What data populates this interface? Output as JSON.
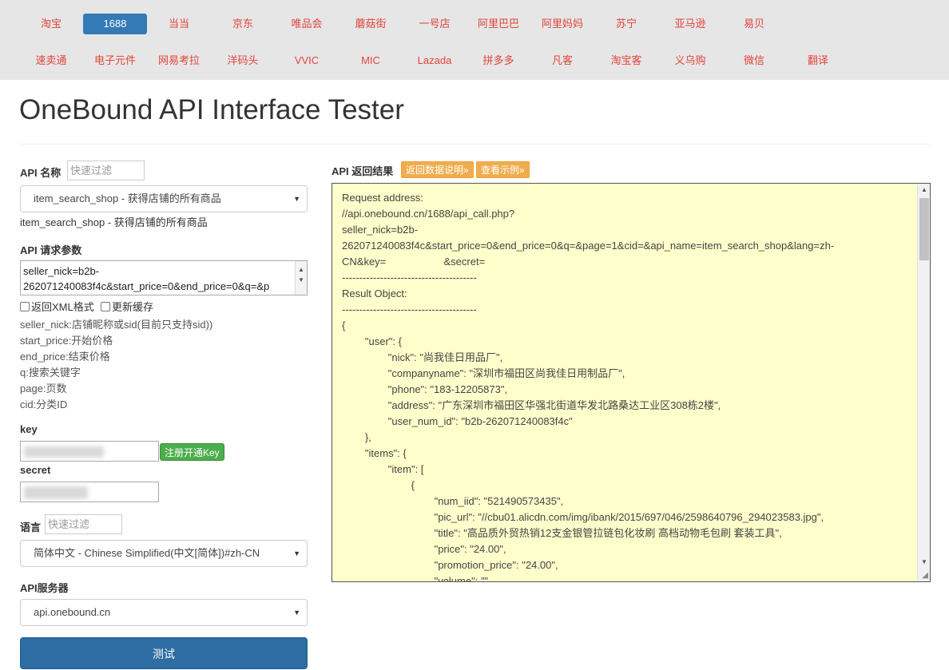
{
  "nav": {
    "row1": [
      {
        "label": "淘宝",
        "active": false
      },
      {
        "label": "1688",
        "active": true
      },
      {
        "label": "当当",
        "active": false
      },
      {
        "label": "京东",
        "active": false
      },
      {
        "label": "唯品会",
        "active": false
      },
      {
        "label": "蘑菇街",
        "active": false
      },
      {
        "label": "一号店",
        "active": false
      },
      {
        "label": "阿里巴巴",
        "active": false
      },
      {
        "label": "阿里妈妈",
        "active": false
      },
      {
        "label": "苏宁",
        "active": false
      },
      {
        "label": "亚马逊",
        "active": false
      },
      {
        "label": "易贝",
        "active": false
      }
    ],
    "row2": [
      {
        "label": "速卖通"
      },
      {
        "label": "电子元件"
      },
      {
        "label": "网易考拉"
      },
      {
        "label": "洋码头"
      },
      {
        "label": "VVIC"
      },
      {
        "label": "MIC"
      },
      {
        "label": "Lazada"
      },
      {
        "label": "拼多多"
      },
      {
        "label": "凡客"
      },
      {
        "label": "淘宝客"
      },
      {
        "label": "义乌购"
      },
      {
        "label": "微信"
      },
      {
        "label": "翻译"
      }
    ]
  },
  "page": {
    "title": "OneBound API Interface Tester"
  },
  "left": {
    "api_name_label": "API 名称",
    "api_filter_placeholder": "快速过滤",
    "api_select_value": "item_search_shop - 获得店铺的所有商品",
    "api_selected_text": "item_search_shop - 获得店铺的所有商品",
    "params_label": "API 请求参数",
    "params_value": "seller_nick=b2b-\n262071240083f4c&start_price=0&end_price=0&q=&p",
    "xml_checkbox": "返回XML格式",
    "cache_checkbox": "更新缓存",
    "param_desc": [
      "seller_nick:店铺昵称或sid(目前只支持sid))",
      "start_price:开始价格",
      "end_price:结束价格",
      "q:搜索关键字",
      "page:页数",
      "cid:分类ID"
    ],
    "key_label": "key",
    "register_key_button": "注册开通Key",
    "secret_label": "secret",
    "lang_label": "语言",
    "lang_filter_placeholder": "快速过滤",
    "lang_select_value": "简体中文 - Chinese Simplified(中文[简体])#zh-CN",
    "server_label": "API服务器",
    "server_select_value": "api.onebound.cn",
    "test_button": "测试"
  },
  "right": {
    "result_label": "API 返回结果",
    "doc_button": "返回数据说明»",
    "example_button": "查看示例»",
    "result_lines": [
      "Request address:",
      "//api.onebound.cn/1688/api_call.php?",
      "seller_nick=b2b-",
      "262071240083f4c&start_price=0&end_price=0&q=&page=1&cid=&api_name=item_search_shop&lang=zh-",
      "CN&key=                    &secret=            ",
      "---------------------------------------",
      "Result Object:",
      "---------------------------------------",
      "{",
      "        \"user\": {",
      "                \"nick\": \"尚我佳日用品厂\",",
      "                \"companyname\": \"深圳市福田区尚我佳日用制品厂\",",
      "                \"phone\": \"183-12205873\",",
      "                \"address\": \"广东深圳市福田区华强北街道华发北路桑达工业区308栋2楼\",",
      "                \"user_num_id\": \"b2b-262071240083f4c\"",
      "        },",
      "        \"items\": {",
      "                \"item\": [",
      "                        {",
      "                                \"num_iid\": \"521490573435\",",
      "                                \"pic_url\": \"//cbu01.alicdn.com/img/ibank/2015/697/046/2598640796_294023583.jpg\",",
      "                                \"title\": \"高品质外贸热销12支金银管拉链包化妆刷 高档动物毛包刷 套装工具\",",
      "                                \"price\": \"24.00\",",
      "                                \"promotion_price\": \"24.00\",",
      "                                \"volume\": \"\""
    ]
  }
}
